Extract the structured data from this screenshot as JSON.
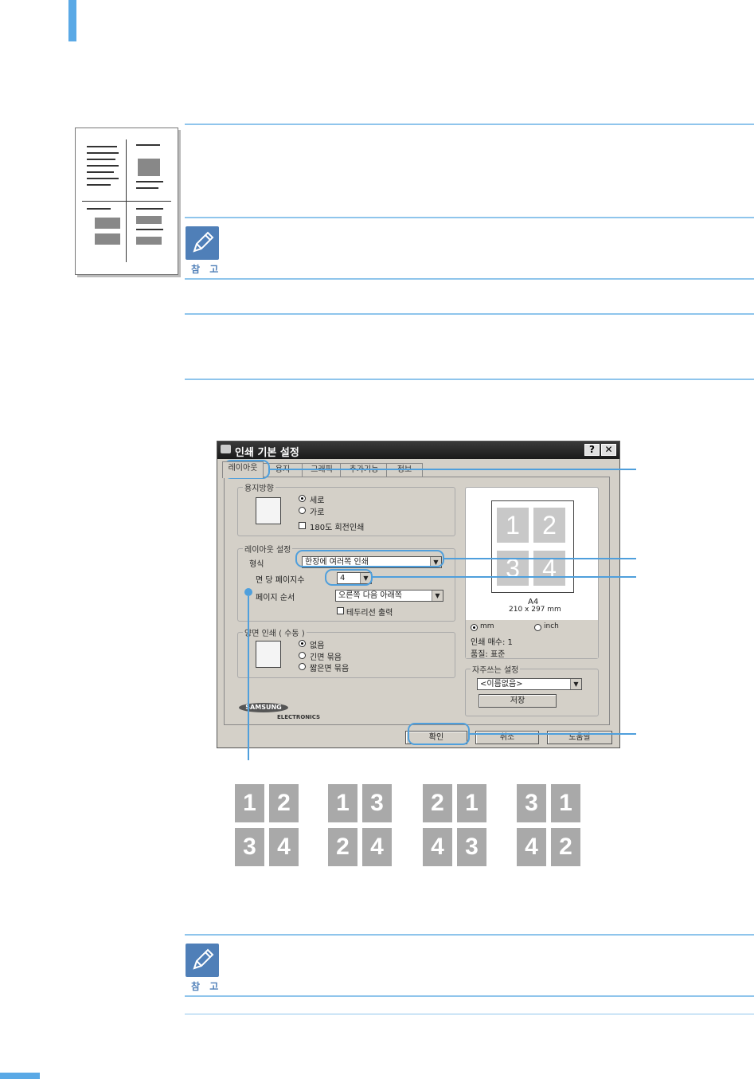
{
  "note_label": "참 고",
  "dialog": {
    "title": "인쇄 기본 설정",
    "help_button": "?",
    "close_button": "✕",
    "tabs": [
      "레이아웃",
      "용지",
      "그래픽",
      "추가기능",
      "정보"
    ],
    "orientation": {
      "legend": "용지방향",
      "portrait": "세로",
      "landscape": "가로",
      "rotate": "180도 회전인쇄"
    },
    "layout": {
      "legend": "레이아웃 설정",
      "type_label": "형식",
      "type_value": "한장에 여러쪽 인쇄",
      "pages_label": "면 당 페이지수",
      "pages_value": "4",
      "order_label": "페이지 순서",
      "order_value": "오른쪽 다음 아래쪽",
      "border_label": "테두리선 출력"
    },
    "duplex": {
      "legend": "양면 인쇄 ( 수동 )",
      "none": "없음",
      "long": "긴면 묶음",
      "short": "짧은면 묶음"
    },
    "preview": {
      "numbers": [
        "1",
        "2",
        "3",
        "4"
      ],
      "paper": "A4",
      "size": "210 x 297 mm",
      "unit_mm": "mm",
      "unit_inch": "inch",
      "copies": "인쇄 매수: 1",
      "quality": "품질: 표준"
    },
    "favorites": {
      "legend": "자주쓰는 설정",
      "value": "<이름없음>",
      "save": "저장"
    },
    "brand": "SAMSUNG",
    "brand_sub": "ELECTRONICS",
    "ok": "확인",
    "cancel": "취소",
    "help": "도움말"
  },
  "order_examples": [
    [
      "1",
      "2",
      "3",
      "4"
    ],
    [
      "1",
      "3",
      "2",
      "4"
    ],
    [
      "2",
      "1",
      "4",
      "3"
    ],
    [
      "3",
      "1",
      "4",
      "2"
    ]
  ]
}
